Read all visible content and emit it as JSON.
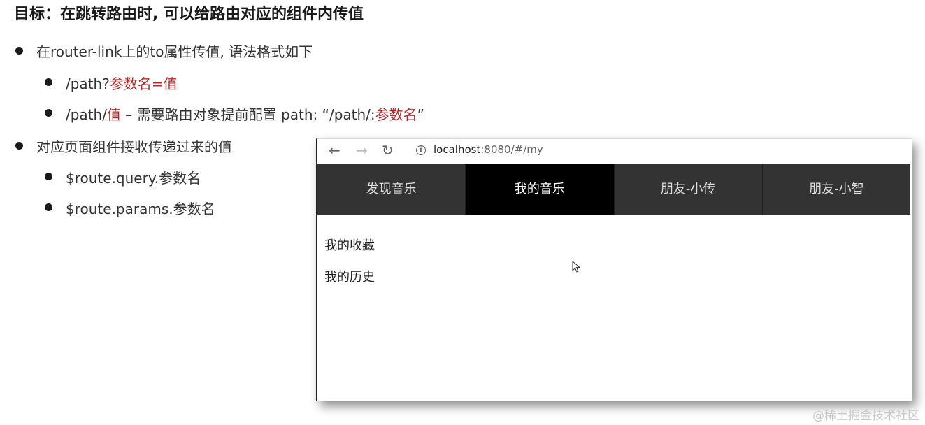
{
  "slide": {
    "title": "目标：在跳转路由时, 可以给路由对应的组件内传值"
  },
  "bullets": {
    "b1": "在router-link上的to属性传值, 语法格式如下",
    "b1_1_a": "/path?",
    "b1_1_b": "参数名=值",
    "b1_2_a": "/path/",
    "b1_2_b": "值",
    "b1_2_c": " – 需要路由对象提前配置 path: “/path/:",
    "b1_2_d": "参数名",
    "b1_2_e": "”",
    "b2": "对应页面组件接收传递过来的值",
    "b2_1": "$route.query.参数名",
    "b2_2": "$route.params.参数名"
  },
  "browser": {
    "url_host": "localhost",
    "url_rest": ":8080/#/my",
    "back_icon": "←",
    "forward_icon": "→",
    "reload_icon": "↻",
    "info_icon": "i",
    "tabs": [
      {
        "label": "发现音乐",
        "active": false
      },
      {
        "label": "我的音乐",
        "active": true
      },
      {
        "label": "朋友-小传",
        "active": false
      },
      {
        "label": "朋友-小智",
        "active": false
      }
    ],
    "content_links": [
      "我的收藏",
      "我的历史"
    ]
  },
  "watermark": "@稀土掘金技术社区",
  "colors": {
    "accent_red": "#b02a2a",
    "tab_bg": "#333333",
    "tab_active_bg": "#000000"
  }
}
